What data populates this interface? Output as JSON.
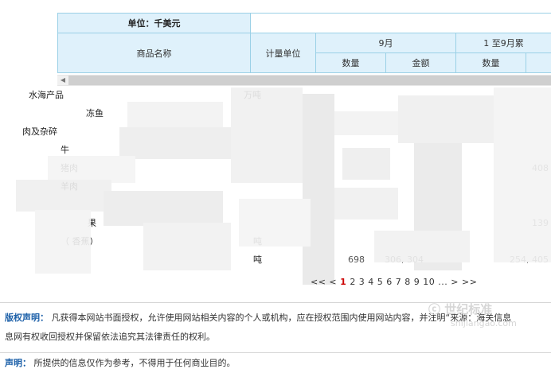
{
  "table": {
    "unit_label": "单位：千美元",
    "col_name": "商品名称",
    "col_measure_unit": "计量单位",
    "month_label": "9月",
    "cumulative_label": "1 至9月累",
    "qty_label": "数量",
    "amount_label": "金额",
    "qty_label2": "数量"
  },
  "rows": [
    {
      "name": "水海产品",
      "indent": 0,
      "unit": "万吨",
      "v1": "",
      "v2": "",
      "v3": ""
    },
    {
      "name": "冻鱼",
      "indent": 2,
      "unit": "",
      "v1": "",
      "v2": "",
      "v3": ""
    },
    {
      "name": "肉及杂碎",
      "indent": 0,
      "unit": "",
      "v1": "",
      "v2": "",
      "v3": ""
    },
    {
      "name": "牛",
      "indent": 1,
      "unit": "",
      "v1": "",
      "v2": "",
      "v3": ""
    },
    {
      "name": "猪肉",
      "indent": 1,
      "unit": "",
      "v1": "",
      "v2": "",
      "v3": "408"
    },
    {
      "name": "羊肉",
      "indent": 1,
      "unit": "",
      "v1": "",
      "v2": "",
      "v3": ""
    },
    {
      "name": "",
      "indent": 1,
      "unit": "",
      "v1": "",
      "v2": "",
      "v3": ""
    },
    {
      "name": "果",
      "indent": 2,
      "unit": "",
      "v1": "",
      "v2": "",
      "v3": "139"
    },
    {
      "name": "（ 香蕉）",
      "indent": 1,
      "unit": "吨",
      "v1": "",
      "v2": "",
      "v3": ""
    },
    {
      "name": "",
      "indent": 0,
      "unit": "吨",
      "v1": "698",
      "v2": "306, 304",
      "v3": "254, 405"
    }
  ],
  "pager": {
    "prev": "<< <",
    "current": "1",
    "pages": "2 3 4 5 6 7 8 9 10 ...",
    "next": "> >>"
  },
  "copyright": {
    "label": "版权声明：",
    "text1": "凡获得本网站书面授权，允许使用网站相关内容的个人或机构，应在授权范围内使用网站内容，并注明“来源：海关信息",
    "text2": "息网有权收回授权并保留依法追究其法律责任的权利。"
  },
  "watermark": {
    "line1": "ⓒ 世纪标准",
    "line2": "shijiangao.com"
  },
  "footer": {
    "label": "声明：",
    "text": "所提供的信息仅作为参考，不得用于任何商业目的。"
  }
}
